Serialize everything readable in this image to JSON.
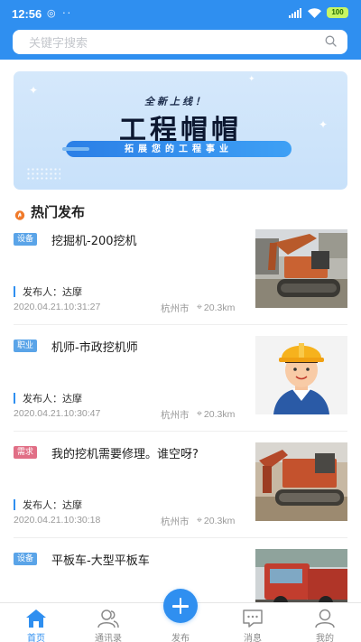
{
  "status_bar": {
    "time": "12:56",
    "battery": "100"
  },
  "search": {
    "placeholder": "关键字搜索"
  },
  "banner": {
    "subtitle": "全新上线！",
    "title": "工程帽帽",
    "ribbon": "拓展您的工程事业"
  },
  "section": {
    "title": "热门发布"
  },
  "posts": [
    {
      "tag": "设备",
      "tag_color": "#5aa4e8",
      "title": "挖掘机-200挖机",
      "publisher": "发布人：达摩",
      "time": "2020.04.21.10:31:27",
      "city": "杭州市",
      "distance": "20.3km",
      "image": "excavator-photo"
    },
    {
      "tag": "职业",
      "tag_color": "#5aa4e8",
      "title": "机师-市政挖机师",
      "publisher": "发布人：达摩",
      "time": "2020.04.21.10:30:47",
      "city": "杭州市",
      "distance": "20.3km",
      "image": "worker-hardhat-illustration"
    },
    {
      "tag": "需求",
      "tag_color": "#e16f86",
      "title": "我的挖机需要修理。谁空呀?",
      "publisher": "发布人：达摩",
      "time": "2020.04.21.10:30:18",
      "city": "杭州市",
      "distance": "20.3km",
      "image": "excavator-repair-photo"
    },
    {
      "tag": "设备",
      "tag_color": "#5aa4e8",
      "title": "平板车-大型平板车",
      "image": "flatbed-truck-photo"
    }
  ],
  "tabbar": {
    "home": "首页",
    "contacts": "通讯录",
    "publish": "发布",
    "messages": "消息",
    "mine": "我的"
  },
  "colors": {
    "primary": "#2f8ff0",
    "tag_blue": "#5aa4e8",
    "tag_pink": "#e16f86"
  }
}
